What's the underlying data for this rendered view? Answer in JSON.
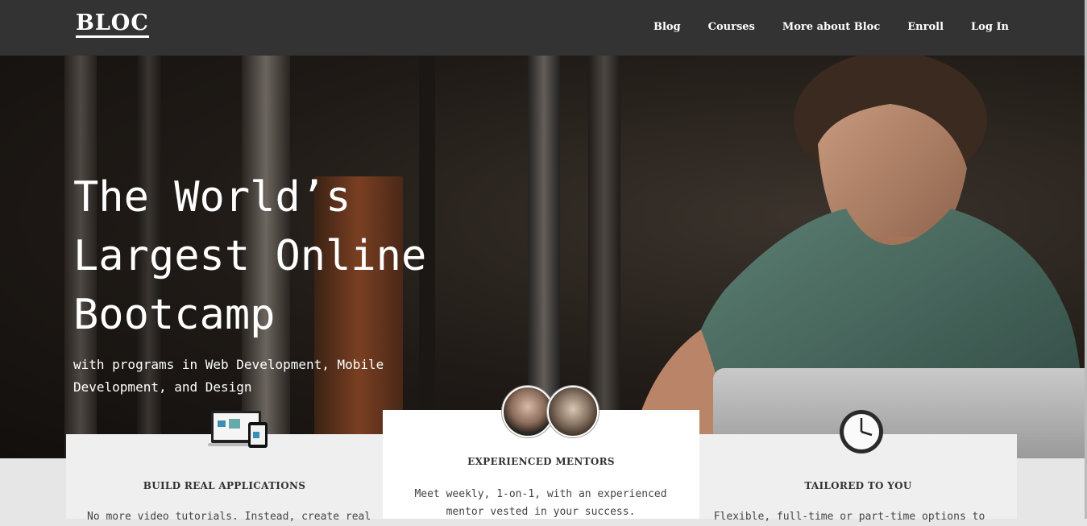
{
  "nav": {
    "logo": "BLOC",
    "links": [
      "Blog",
      "Courses",
      "More about Bloc",
      "Enroll",
      "Log In"
    ]
  },
  "hero": {
    "headline_lines": [
      "The World’s",
      "Largest Online",
      "Bootcamp"
    ],
    "subtitle": "with programs in Web Development, Mobile Development, and Design"
  },
  "features": [
    {
      "icon": "devices-icon",
      "title": "BUILD REAL APPLICATIONS",
      "text": "No more video tutorials. Instead, create real"
    },
    {
      "icon": "mentor-avatars",
      "title": "EXPERIENCED MENTORS",
      "text": "Meet weekly, 1-on-1, with an experienced mentor vested in your success."
    },
    {
      "icon": "clock-icon",
      "title": "TAILORED TO YOU",
      "text": "Flexible, full-time or part-time options to"
    }
  ],
  "colors": {
    "nav_bg": "#333333",
    "card_bg": "#efefef",
    "page_bg": "#e6e6e6"
  }
}
